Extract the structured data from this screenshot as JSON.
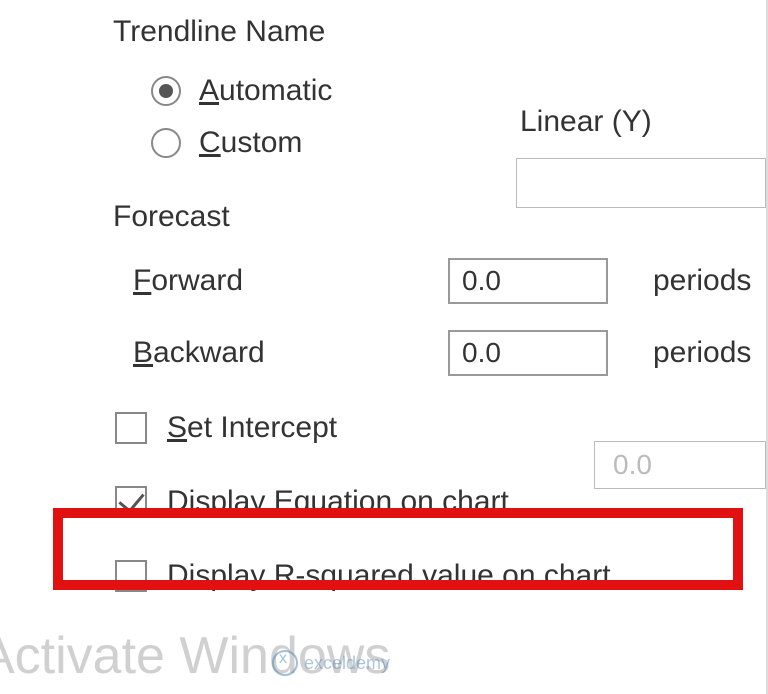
{
  "section": {
    "trendline_title": "Trendline Name",
    "forecast_title": "Forecast"
  },
  "name": {
    "automatic_prefix": "A",
    "automatic_rest": "utomatic",
    "custom_prefix": "C",
    "custom_rest": "ustom",
    "selected": "automatic",
    "display": "Linear (Y)",
    "custom_value": ""
  },
  "forecast": {
    "forward_prefix": "F",
    "forward_rest": "orward",
    "forward_value": "0.0",
    "forward_unit": "periods",
    "backward_prefix": "B",
    "backward_rest": "ackward",
    "backward_value": "0.0",
    "backward_unit": "periods"
  },
  "intercept": {
    "prefix": "S",
    "rest": "et Intercept",
    "value": "0.0",
    "checked": false
  },
  "display_eq": {
    "pre": "Display ",
    "ul": "E",
    "post": "quation on chart",
    "checked": true
  },
  "display_r2": {
    "pre": "Display ",
    "ul": "R",
    "post": "-squared value on chart",
    "checked": false
  },
  "watermark": "Activate Windows",
  "brand": "exceldemy"
}
